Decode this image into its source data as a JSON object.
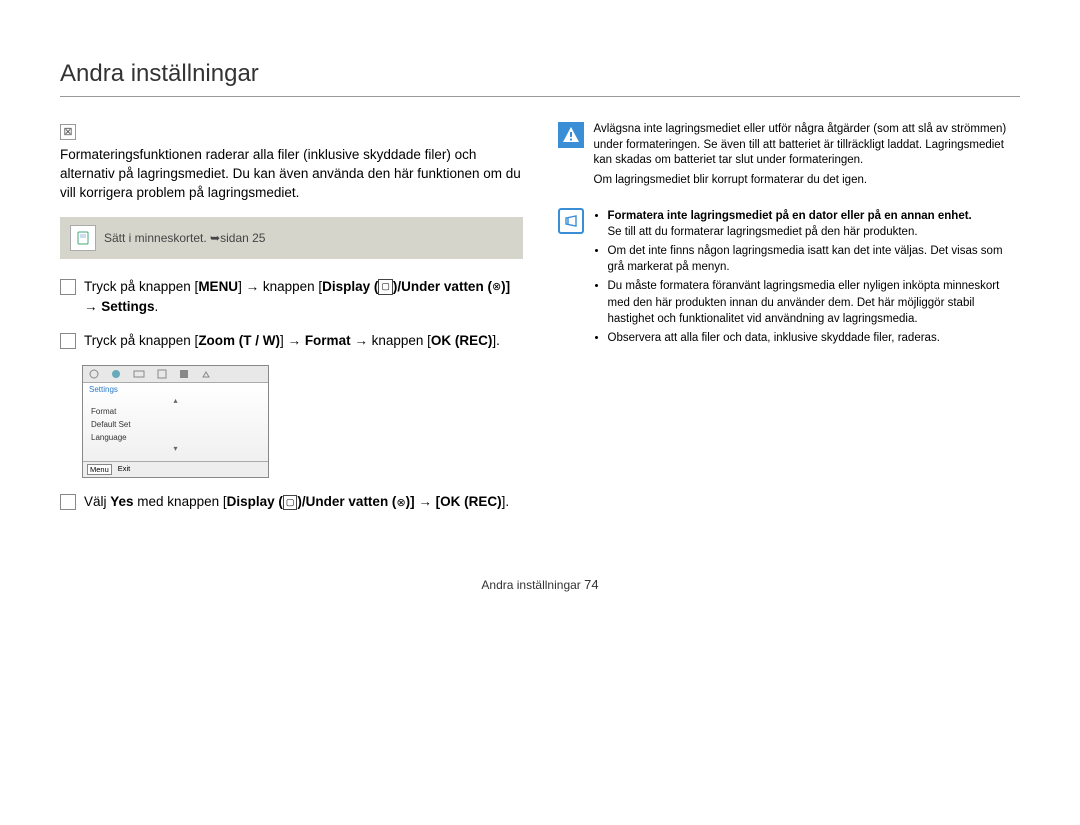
{
  "title": "Andra inställningar",
  "section_symbol": "⊠",
  "intro": "Formateringsfunktionen raderar alla filer (inklusive skyddade filer) och alternativ på lagringsmediet. Du kan även använda den här funktionen om du vill korrigera problem på lagringsmediet.",
  "refbox": {
    "text": "Sätt i minneskortet. ➥sidan 25"
  },
  "steps": {
    "s1_pre": "Tryck på knappen [",
    "s1_menu": "MENU",
    "s1_mid1": "] → knappen [",
    "s1_display": "Display (",
    "s1_mid2": ")/",
    "s1_under": "Under vatten (",
    "s1_mid3": ")] → ",
    "s1_settings": "Settings",
    "s1_end": ".",
    "s2_pre": "Tryck på knappen [",
    "s2_zoom": "Zoom (T / W)",
    "s2_mid1": "] → ",
    "s2_format": "Format",
    "s2_mid2": " → knappen [",
    "s2_ok": "OK (REC)",
    "s2_end": "].",
    "s3_pre": "Välj ",
    "s3_yes": "Yes",
    "s3_mid1": " med knappen [",
    "s3_display": "Display (",
    "s3_mid2": ")/Under vatten (",
    "s3_mid3": ")] → [",
    "s3_ok": "OK (REC)",
    "s3_end": "]."
  },
  "screenshot": {
    "title": "Settings",
    "item1": "Format",
    "item2": "Default Set",
    "item3": "Language",
    "footer_menu": "Menu",
    "footer_exit": "Exit"
  },
  "warning": {
    "p1": "Avlägsna inte lagringsmediet eller utför några åtgärder (som att slå av strömmen) under formateringen. Se även till att batteriet är tillräckligt laddat. Lagringsmediet kan skadas om batteriet tar slut under formateringen.",
    "p2": "Om lagringsmediet blir korrupt formaterar du det igen."
  },
  "notes": {
    "n1": "Formatera inte lagringsmediet på en dator eller på en annan enhet.",
    "n1b": "Se till att du formaterar lagringsmediet på den här produkten.",
    "n2": "Om det inte finns någon lagringsmedia isatt kan det inte väljas. Det visas som grå markerat på menyn.",
    "n3": "Du måste formatera föranvänt lagringsmedia eller nyligen inköpta minneskort med den här produkten innan du använder dem. Det här möjliggör stabil hastighet och funktionalitet vid användning av lagringsmedia.",
    "n4": "Observera att alla filer och data, inklusive skyddade filer, raderas."
  },
  "footer": {
    "text": "Andra inställningar",
    "page": "74"
  }
}
